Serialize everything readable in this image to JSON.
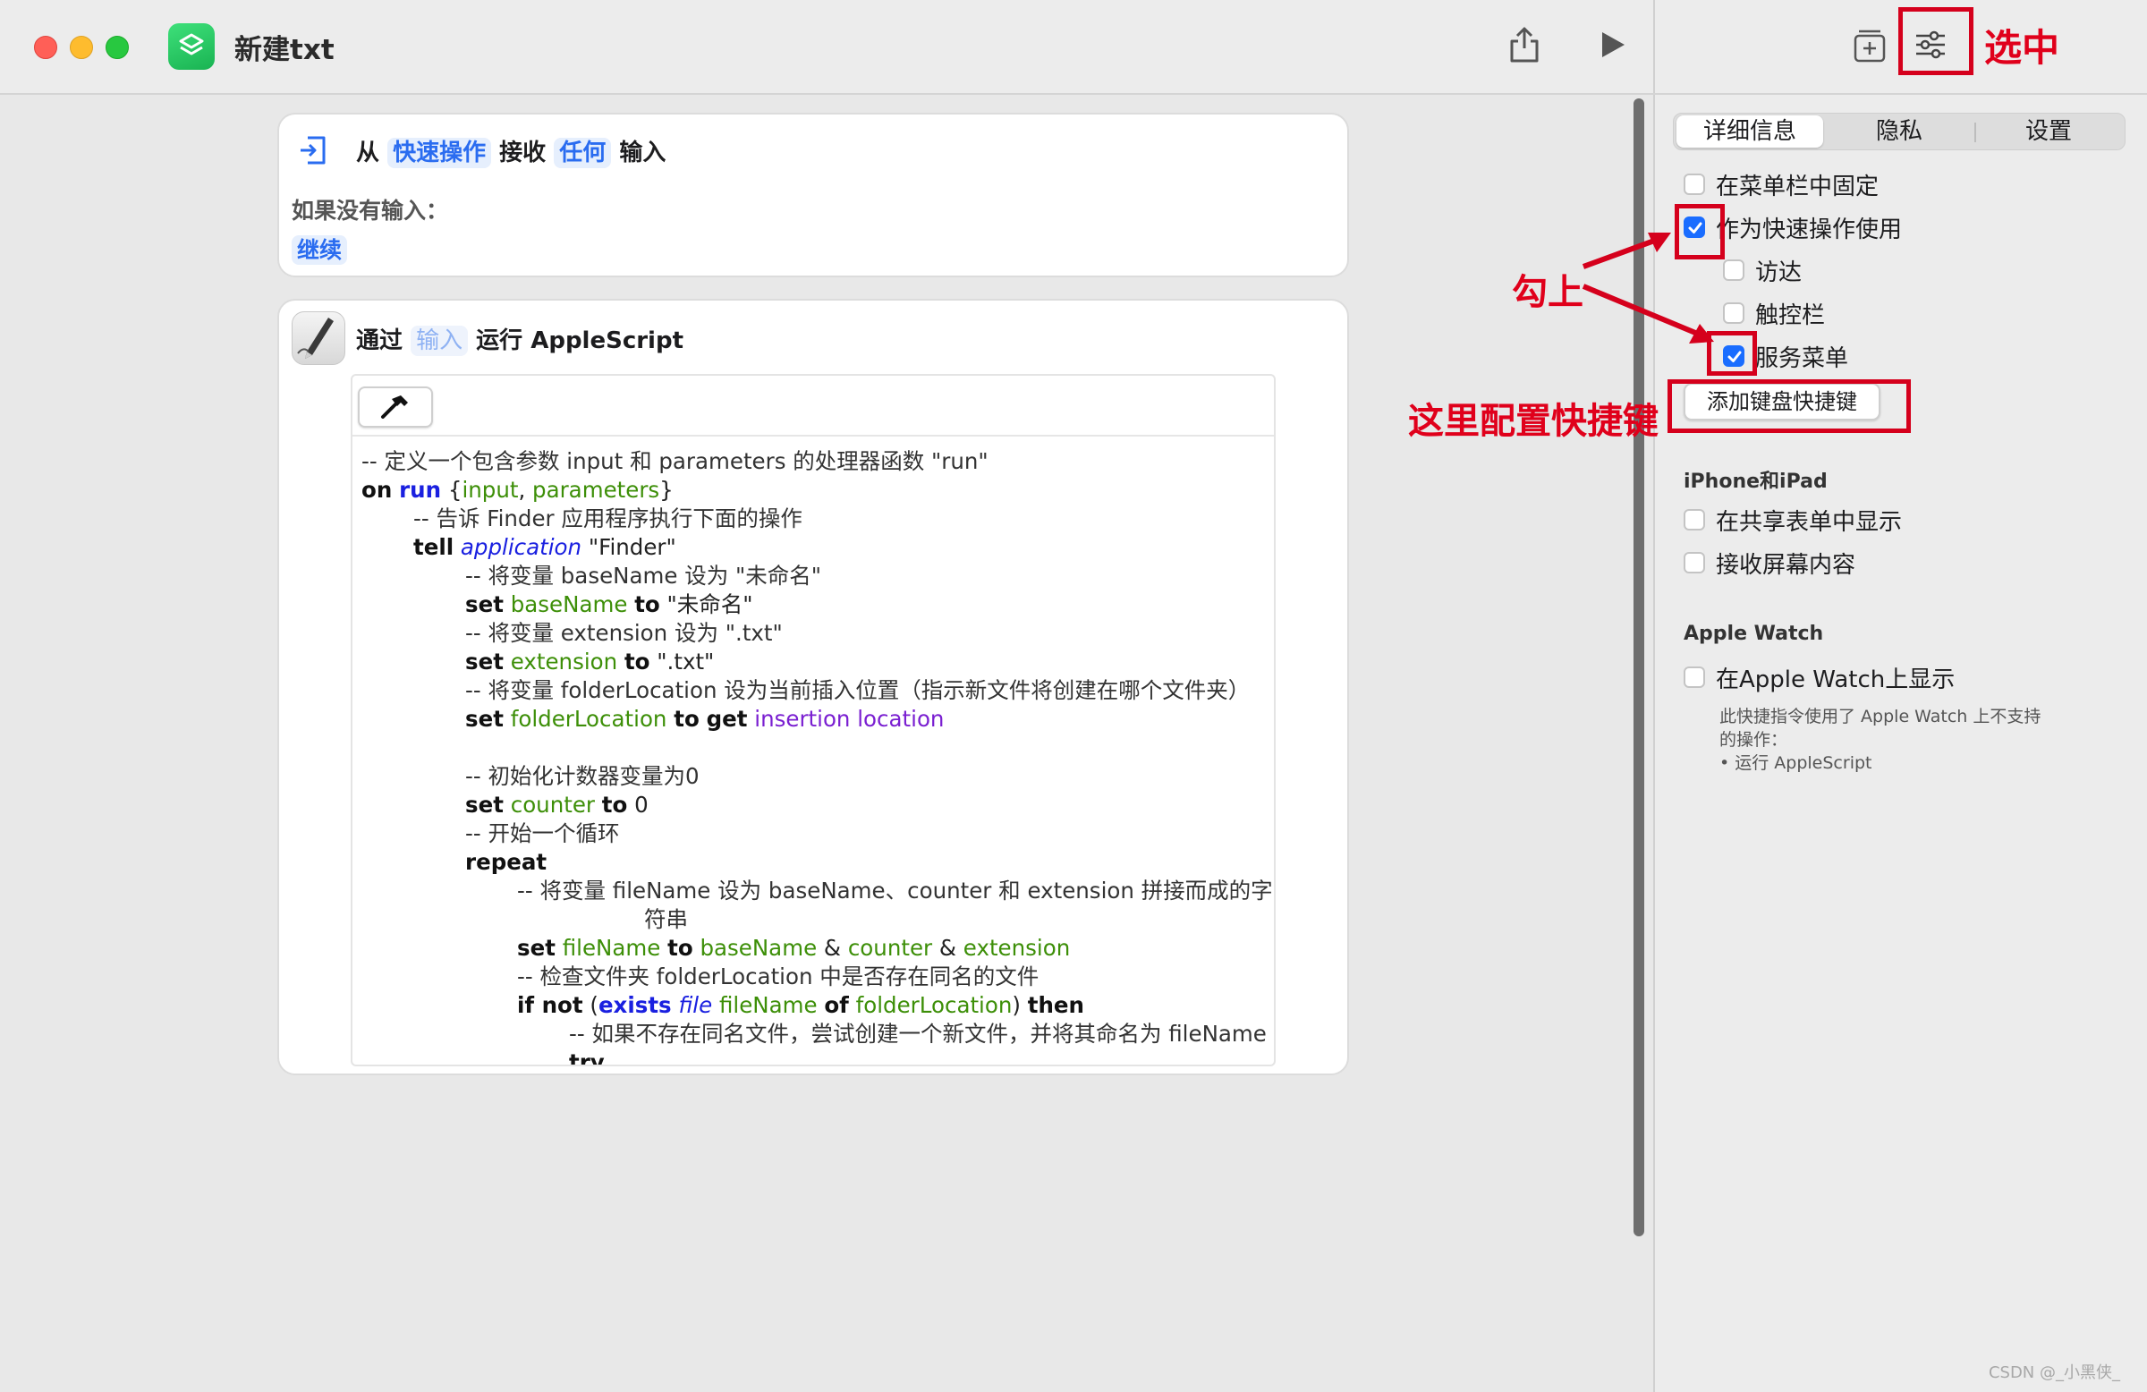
{
  "window": {
    "title": "新建txt",
    "colors": {
      "close": "#ff5f57",
      "minimize": "#febc2e",
      "maximize": "#28c840",
      "app_icon": "#25c661"
    },
    "toolbar_icons": [
      "shortcuts-app-icon",
      "share-icon",
      "run-icon"
    ]
  },
  "actions": {
    "receive": {
      "prefix": "从",
      "source": "快速操作",
      "middle": "接收",
      "type": "任何",
      "suffix": "输入",
      "no_input_label": "如果没有输入：",
      "no_input_value": "继续"
    },
    "applescript": {
      "prefix": "通过",
      "token": "输入",
      "suffix": "运行 AppleScript"
    }
  },
  "code": {
    "l1": "-- 定义一个包含参数 input 和 parameters 的处理器函数 \"run\"",
    "l2_kw": "on",
    "l2_kw2": "run",
    "l2_open": " {",
    "l2_v1": "input",
    "l2_comma": ", ",
    "l2_v2": "parameters",
    "l2_close": "}",
    "l3": "-- 告诉 Finder 应用程序执行下面的操作",
    "l4_kw": "tell",
    "l4_it": "application",
    "l4_str": " \"Finder\"",
    "l5": "-- 将变量 baseName 设为 \"未命名\"",
    "l6_kw": "set",
    "l6_var": "baseName",
    "l6_kw2": "to",
    "l6_str": " \"未命名\"",
    "l7": "-- 将变量 extension 设为 \".txt\"",
    "l8_kw": "set",
    "l8_var": "extension",
    "l8_kw2": "to",
    "l8_str": " \".txt\"",
    "l9": "-- 将变量 folderLocation 设为当前插入位置（指示新文件将创建在哪个文件夹）",
    "l10_kw": "set",
    "l10_var": "folderLocation",
    "l10_kw2": "to",
    "l10_kw3": "get",
    "l10_prop": "insertion location",
    "l11": "-- 初始化计数器变量为0",
    "l12_kw": "set",
    "l12_var": "counter",
    "l12_kw2": "to",
    "l12_num": " 0",
    "l13": "-- 开始一个循环",
    "l14_kw": "repeat",
    "l15a": "-- 将变量 fileName 设为 baseName、counter 和 extension 拼接而成的字",
    "l15b": "符串",
    "l16_kw": "set",
    "l16_var": "fileName",
    "l16_kw2": "to",
    "l16_v1": "baseName",
    "l16_amp1": " & ",
    "l16_v2": "counter",
    "l16_amp2": " & ",
    "l16_v3": "extension",
    "l17": "-- 检查文件夹 folderLocation 中是否存在同名的文件",
    "l18_kw": "if not",
    "l18_open": " (",
    "l18_kwb": "exists",
    "l18_it": "file",
    "l18_v1": "fileName",
    "l18_kw2": "of",
    "l18_v2": "folderLocation",
    "l18_close": ")",
    "l18_kw3": "then",
    "l19": "-- 如果不存在同名文件，尝试创建一个新文件，并将其命名为 fileName",
    "l20": "try",
    "colors": {
      "keyword_blue": "#1a20e0",
      "variable": "#3d8f08",
      "property": "#7a1fd1"
    }
  },
  "panel": {
    "tabs": [
      "详细信息",
      "隐私",
      "设置"
    ],
    "selected_tab": "详细信息",
    "options": {
      "pin_menubar": {
        "label": "在菜单栏中固定",
        "checked": false
      },
      "quick_action": {
        "label": "作为快速操作使用",
        "checked": true
      },
      "finder": {
        "label": "访达",
        "checked": false
      },
      "touchbar": {
        "label": "触控栏",
        "checked": false
      },
      "services": {
        "label": "服务菜单",
        "checked": true
      }
    },
    "keyboard_button": "添加键盘快捷键",
    "iphone_section": "iPhone和iPad",
    "share_sheet": {
      "label": "在共享表单中显示",
      "checked": false
    },
    "receive_screen": {
      "label": "接收屏幕内容",
      "checked": false
    },
    "watch_section": "Apple Watch",
    "show_on_watch": {
      "label": "在Apple Watch上显示",
      "checked": false
    },
    "watch_note_1": "此快捷指令使用了 Apple Watch 上不支持",
    "watch_note_2": "的操作：",
    "watch_note_3": "• 运行 AppleScript",
    "accent": "#1a6dff"
  },
  "annotations": {
    "selected": "选中",
    "check": "勾上",
    "config_shortcut": "这里配置快捷键",
    "color": "#d5001c"
  },
  "watermark": "CSDN @_小黑侠_"
}
